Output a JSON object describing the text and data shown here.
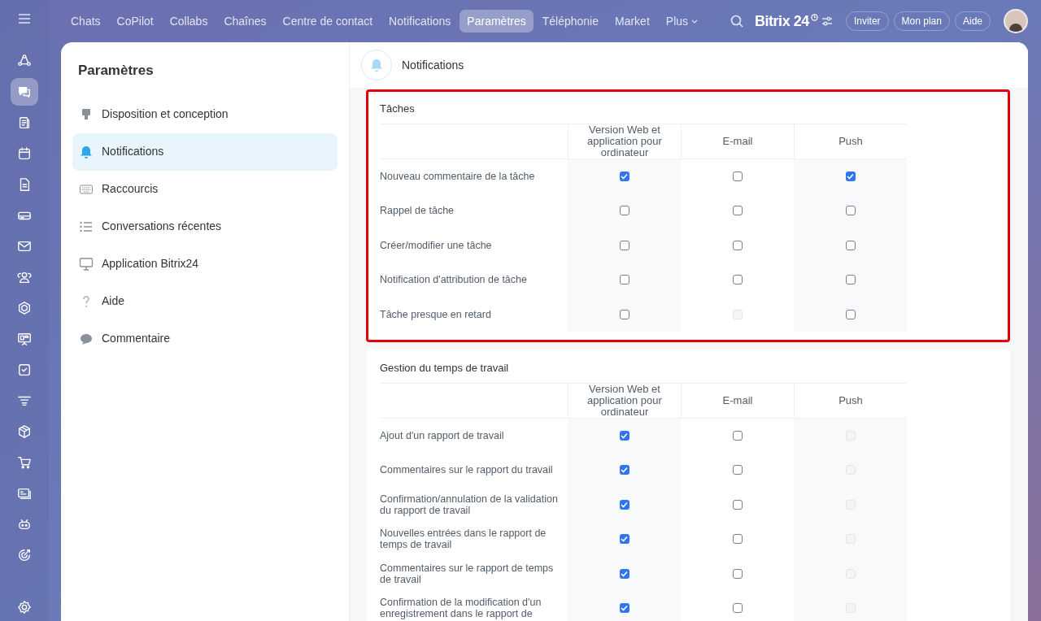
{
  "top_nav": {
    "items": [
      {
        "label": "Chats",
        "selected": false
      },
      {
        "label": "CoPilot",
        "selected": false
      },
      {
        "label": "Collabs",
        "selected": false
      },
      {
        "label": "Chaînes",
        "selected": false
      },
      {
        "label": "Centre de contact",
        "selected": false
      },
      {
        "label": "Notifications",
        "selected": false
      },
      {
        "label": "Paramètres",
        "selected": true
      },
      {
        "label": "Téléphonie",
        "selected": false
      },
      {
        "label": "Market",
        "selected": false
      }
    ],
    "more": "Plus",
    "logo": "Bitrix 24",
    "buttons": [
      "Inviter",
      "Mon plan",
      "Aide"
    ]
  },
  "left_rail": {
    "items": [
      {
        "kind": "network",
        "selected": false
      },
      {
        "kind": "chat",
        "selected": true
      },
      {
        "kind": "feed",
        "selected": false
      },
      {
        "kind": "calendar",
        "selected": false
      },
      {
        "kind": "document",
        "selected": false
      },
      {
        "kind": "drive",
        "selected": false
      },
      {
        "kind": "mail",
        "selected": false
      },
      {
        "kind": "people",
        "selected": false
      },
      {
        "kind": "hexagon",
        "selected": false
      },
      {
        "kind": "board",
        "selected": false
      },
      {
        "kind": "check",
        "selected": false
      },
      {
        "kind": "funnel",
        "selected": false
      },
      {
        "kind": "box",
        "selected": false
      },
      {
        "kind": "cart",
        "selected": false
      },
      {
        "kind": "card",
        "selected": false
      },
      {
        "kind": "robot",
        "selected": false
      },
      {
        "kind": "target",
        "selected": false
      },
      {
        "kind": "gear",
        "selected": false
      }
    ]
  },
  "sidebar": {
    "title": "Paramètres",
    "items": [
      {
        "kind": "brush",
        "label": "Disposition et conception",
        "selected": false
      },
      {
        "kind": "bell",
        "label": "Notifications",
        "selected": true
      },
      {
        "kind": "keyboard",
        "label": "Raccourcis",
        "selected": false
      },
      {
        "kind": "list",
        "label": "Conversations récentes",
        "selected": false
      },
      {
        "kind": "monitor",
        "label": "Application Bitrix24",
        "selected": false
      },
      {
        "kind": "help",
        "label": "Aide",
        "selected": false
      },
      {
        "kind": "comment",
        "label": "Commentaire",
        "selected": false
      }
    ]
  },
  "content": {
    "title": "Notifications",
    "sections": [
      {
        "title": "Tâches",
        "highlighted": true,
        "columns": [
          "Version Web et application pour ordinateur",
          "E-mail",
          "Push"
        ],
        "rows": [
          {
            "label": "Nouveau commentaire de la tâche",
            "cells": [
              {
                "checked": true,
                "disabled": false
              },
              {
                "checked": false,
                "disabled": false
              },
              {
                "checked": true,
                "disabled": false
              }
            ]
          },
          {
            "label": "Rappel de tâche",
            "cells": [
              {
                "checked": false,
                "disabled": false
              },
              {
                "checked": false,
                "disabled": false
              },
              {
                "checked": false,
                "disabled": false
              }
            ]
          },
          {
            "label": "Créer/modifier une tâche",
            "cells": [
              {
                "checked": false,
                "disabled": false
              },
              {
                "checked": false,
                "disabled": false
              },
              {
                "checked": false,
                "disabled": false
              }
            ]
          },
          {
            "label": "Notification d'attribution de tâche",
            "cells": [
              {
                "checked": false,
                "disabled": false
              },
              {
                "checked": false,
                "disabled": false
              },
              {
                "checked": false,
                "disabled": false
              }
            ]
          },
          {
            "label": "Tâche presque en retard",
            "cells": [
              {
                "checked": false,
                "disabled": false
              },
              {
                "checked": false,
                "disabled": true
              },
              {
                "checked": false,
                "disabled": false
              }
            ]
          }
        ]
      },
      {
        "title": "Gestion du temps de travail",
        "highlighted": false,
        "columns": [
          "Version Web et application pour ordinateur",
          "E-mail",
          "Push"
        ],
        "rows": [
          {
            "label": "Ajout d'un rapport de travail",
            "cells": [
              {
                "checked": true,
                "disabled": false
              },
              {
                "checked": false,
                "disabled": false
              },
              {
                "checked": false,
                "disabled": true
              }
            ]
          },
          {
            "label": "Commentaires sur le rapport du travail",
            "cells": [
              {
                "checked": true,
                "disabled": false
              },
              {
                "checked": false,
                "disabled": false
              },
              {
                "checked": false,
                "disabled": true
              }
            ]
          },
          {
            "label": "Confirmation/annulation de la validation du rapport de travail",
            "cells": [
              {
                "checked": true,
                "disabled": false
              },
              {
                "checked": false,
                "disabled": false
              },
              {
                "checked": false,
                "disabled": true
              }
            ]
          },
          {
            "label": "Nouvelles entrées dans le rapport de temps de travail",
            "cells": [
              {
                "checked": true,
                "disabled": false
              },
              {
                "checked": false,
                "disabled": false
              },
              {
                "checked": false,
                "disabled": true
              }
            ]
          },
          {
            "label": "Commentaires sur le rapport de temps de travail",
            "cells": [
              {
                "checked": true,
                "disabled": false
              },
              {
                "checked": false,
                "disabled": false
              },
              {
                "checked": false,
                "disabled": true
              }
            ]
          },
          {
            "label": "Confirmation de la modification d'un enregistrement dans le rapport de",
            "cells": [
              {
                "checked": true,
                "disabled": false
              },
              {
                "checked": false,
                "disabled": false
              },
              {
                "checked": false,
                "disabled": true
              }
            ]
          }
        ]
      }
    ]
  }
}
